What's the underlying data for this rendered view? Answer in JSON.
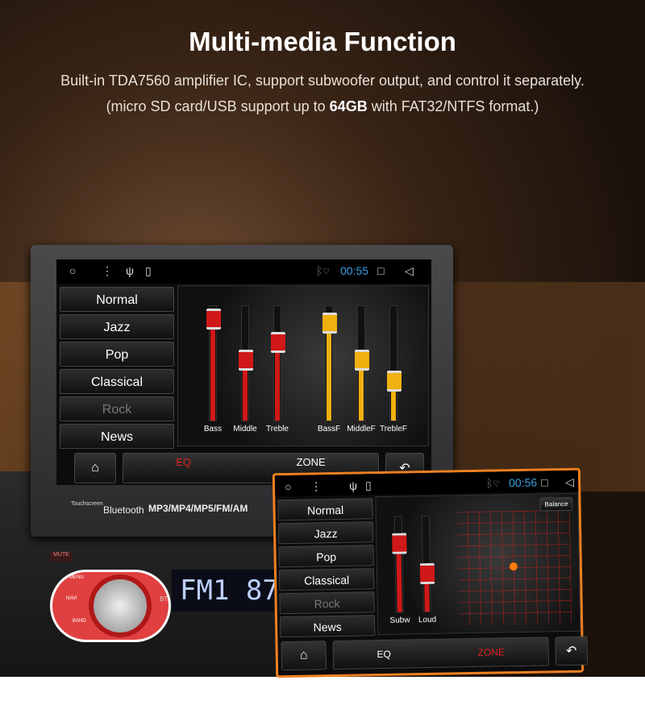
{
  "header": {
    "title": "Multi-media Function",
    "line1": "Built-in TDA7560 amplifier IC, support subwoofer output, and control it separately.",
    "line2_pre": "(micro SD card/USB support up to ",
    "line2_bold": "64GB",
    "line2_post": " with FAT32/NTFS format.)"
  },
  "main_screen": {
    "status": {
      "time": "00:55",
      "icons": [
        "circle-icon",
        "menu-dots-icon",
        "usb-icon",
        "sd-card-icon",
        "bluetooth-icon",
        "wifi-icon",
        "square-icon",
        "back-triangle-icon"
      ]
    },
    "presets": [
      {
        "label": "Normal"
      },
      {
        "label": "Jazz"
      },
      {
        "label": "Pop"
      },
      {
        "label": "Classical"
      },
      {
        "label": "Rock",
        "dim": true
      },
      {
        "label": "News"
      }
    ],
    "sliders": [
      {
        "label": "Bass",
        "level": 0.95,
        "color": "#d01818"
      },
      {
        "label": "Middle",
        "level": 0.6,
        "color": "#d01818"
      },
      {
        "label": "Treble",
        "level": 0.75,
        "color": "#d01818"
      },
      {
        "label": "BassF",
        "level": 0.92,
        "color": "#f0b010"
      },
      {
        "label": "MiddleF",
        "level": 0.6,
        "color": "#f0b010"
      },
      {
        "label": "TrebleF",
        "level": 0.42,
        "color": "#f0b010"
      }
    ],
    "tabs": {
      "eq": "EQ",
      "zone": "ZONE"
    }
  },
  "device": {
    "touchscreen": "Touchscreen",
    "bluetooth": "Bluetooth",
    "formats": "MP3/MP4/MP5/FM/AM",
    "mute": "MUTE",
    "menu": "MENU",
    "navi": "NAVI",
    "band": "BAND",
    "bt": "BT",
    "display": "FM1 87"
  },
  "zone_screen": {
    "status": {
      "time": "00:56"
    },
    "presets": [
      {
        "label": "Normal"
      },
      {
        "label": "Jazz"
      },
      {
        "label": "Pop"
      },
      {
        "label": "Classical"
      },
      {
        "label": "Rock",
        "dim": true
      },
      {
        "label": "News"
      }
    ],
    "balance": "Balance",
    "sliders": [
      {
        "label": "Subw",
        "level": 0.8,
        "color": "#d01818"
      },
      {
        "label": "Loud",
        "level": 0.48,
        "color": "#d01818"
      }
    ],
    "tabs": {
      "eq": "EQ",
      "zone": "ZONE"
    }
  }
}
